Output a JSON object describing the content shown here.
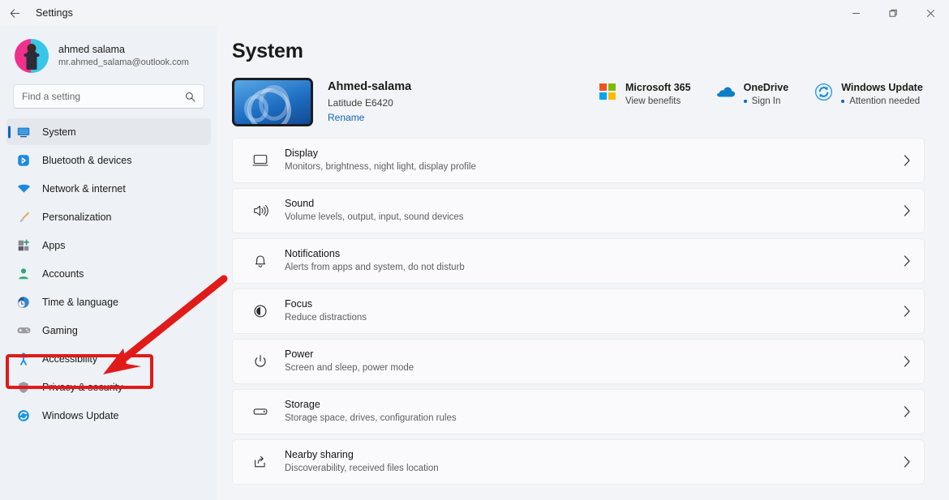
{
  "window": {
    "title": "Settings",
    "back_icon": "back-arrow-icon",
    "minimize_label": "Minimize",
    "maximize_label": "Restore",
    "close_label": "Close"
  },
  "account": {
    "name": "ahmed salama",
    "email": "mr.ahmed_salama@outlook.com",
    "avatar_icon": "user-avatar"
  },
  "search": {
    "placeholder": "Find a setting",
    "value": "",
    "icon": "search-icon"
  },
  "sidebar": {
    "items": [
      {
        "label": "System",
        "icon": "monitor-icon",
        "selected": true
      },
      {
        "label": "Bluetooth & devices",
        "icon": "bluetooth-icon",
        "selected": false
      },
      {
        "label": "Network & internet",
        "icon": "wifi-icon",
        "selected": false
      },
      {
        "label": "Personalization",
        "icon": "paintbrush-icon",
        "selected": false
      },
      {
        "label": "Apps",
        "icon": "apps-icon",
        "selected": false
      },
      {
        "label": "Accounts",
        "icon": "person-icon",
        "selected": false
      },
      {
        "label": "Time & language",
        "icon": "clock-globe-icon",
        "selected": false
      },
      {
        "label": "Gaming",
        "icon": "gamepad-icon",
        "selected": false
      },
      {
        "label": "Accessibility",
        "icon": "accessibility-icon",
        "selected": false
      },
      {
        "label": "Privacy & security",
        "icon": "shield-icon",
        "selected": false
      },
      {
        "label": "Windows Update",
        "icon": "update-sync-icon",
        "selected": false
      }
    ]
  },
  "main": {
    "page_title": "System",
    "device": {
      "name": "Ahmed-salama",
      "model": "Latitude E6420",
      "rename_label": "Rename",
      "thumbnail_icon": "windows-bloom-wallpaper"
    },
    "status_widgets": [
      {
        "title": "Microsoft 365",
        "subtitle": "View benefits",
        "icon": "microsoft-logo-icon",
        "has_dot": false
      },
      {
        "title": "OneDrive",
        "subtitle": "Sign In",
        "icon": "onedrive-cloud-icon",
        "has_dot": true
      },
      {
        "title": "Windows Update",
        "subtitle": "Attention needed",
        "icon": "update-sync-icon",
        "has_dot": true
      }
    ],
    "settings_rows": [
      {
        "title": "Display",
        "subtitle": "Monitors, brightness, night light, display profile",
        "icon": "display-monitor-icon"
      },
      {
        "title": "Sound",
        "subtitle": "Volume levels, output, input, sound devices",
        "icon": "speaker-icon"
      },
      {
        "title": "Notifications",
        "subtitle": "Alerts from apps and system, do not disturb",
        "icon": "bell-icon"
      },
      {
        "title": "Focus",
        "subtitle": "Reduce distractions",
        "icon": "focus-moon-icon"
      },
      {
        "title": "Power",
        "subtitle": "Screen and sleep, power mode",
        "icon": "power-icon"
      },
      {
        "title": "Storage",
        "subtitle": "Storage space, drives, configuration rules",
        "icon": "storage-drive-icon"
      },
      {
        "title": "Nearby sharing",
        "subtitle": "Discoverability, received files location",
        "icon": "share-icon"
      }
    ],
    "chevron_icon": "chevron-right-icon"
  },
  "annotation": {
    "highlight_target": "Accessibility",
    "color": "#e11a1a",
    "arrow_icon": "pointer-arrow-icon",
    "box_icon": "highlight-box"
  },
  "colors": {
    "accent": "#0a64c8",
    "sidebar_bg": "#eef1f5",
    "main_bg": "#f3f4f7",
    "row_bg": "#fafafc",
    "annotation_red": "#e11a1a",
    "link_blue": "#1563b5"
  }
}
